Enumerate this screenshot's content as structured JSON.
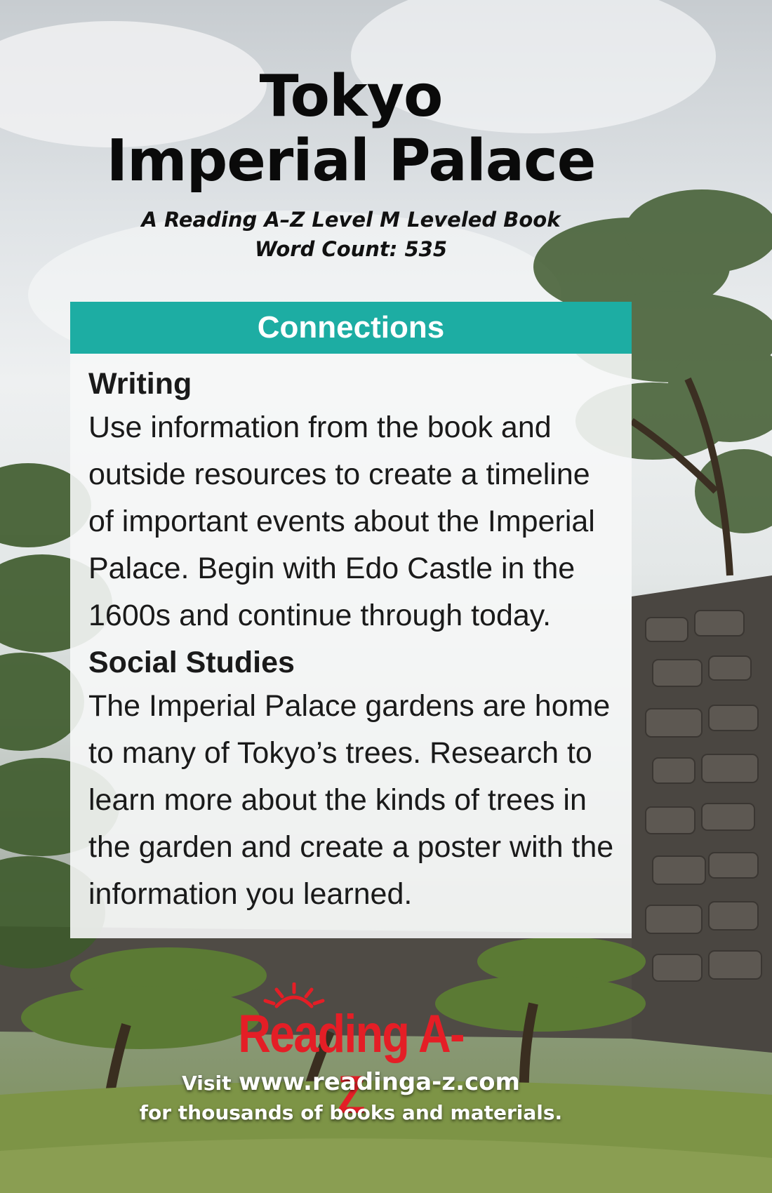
{
  "cover": {
    "title_line1": "Tokyo",
    "title_line2": "Imperial Palace",
    "subtitle_line1": "A Reading A–Z Level M Leveled Book",
    "subtitle_line2": "Word Count: 535"
  },
  "connections": {
    "header": "Connections",
    "sections": [
      {
        "title": "Writing",
        "text": "Use information from the book and outside resources to create a timeline of important events about the Imperial Palace. Begin with Edo Castle in the 1600s and continue through today."
      },
      {
        "title": "Social Studies",
        "text": "The Imperial Palace gardens are home to many of Tokyo’s trees. Research to learn more about the kinds of trees in the garden and create a poster with the information you learned."
      }
    ]
  },
  "logo": {
    "text": "Reading A-Z",
    "color": "#e41e26"
  },
  "footer": {
    "visit_label": "Visit",
    "url": "www.readinga-z.com",
    "tagline": "for thousands of books and materials."
  },
  "colors": {
    "header_teal": "#1dada3",
    "panel_bg": "#f6f7f7"
  }
}
